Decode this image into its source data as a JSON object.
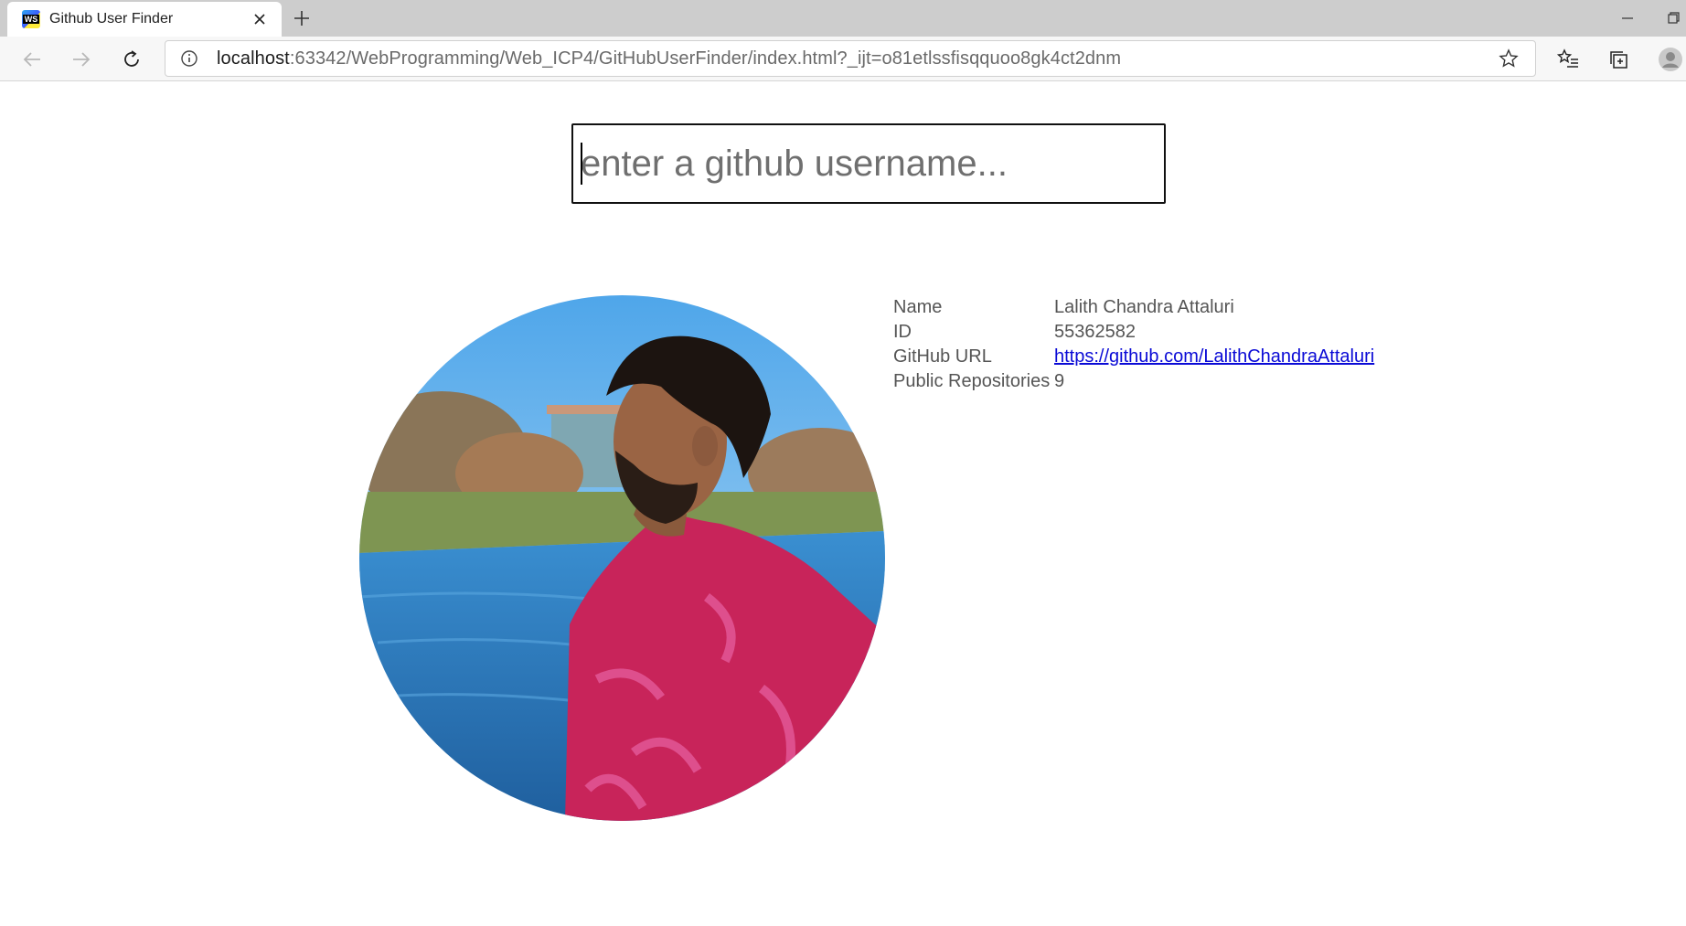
{
  "browser": {
    "tab_title": "Github User Finder",
    "favicon_text": "WS",
    "url_host": "localhost",
    "url_rest": ":63342/WebProgramming/Web_ICP4/GitHubUserFinder/index.html?_ijt=o81etlssfisqquoo8gk4ct2dnm"
  },
  "search": {
    "placeholder": "enter a github username..."
  },
  "profile": {
    "rows": [
      {
        "label": "Name",
        "value": "Lalith Chandra Attaluri"
      },
      {
        "label": "ID",
        "value": "55362582"
      },
      {
        "label": "GitHub URL",
        "value": "https://github.com/LalithChandraAttaluri"
      },
      {
        "label": "Public Repositories",
        "value": "9"
      }
    ]
  },
  "icons": {
    "tab": [
      "close-icon",
      "plus-icon"
    ],
    "window": [
      "minimize-icon",
      "restore-icon"
    ],
    "nav": [
      "back-arrow-icon",
      "forward-arrow-icon",
      "refresh-icon",
      "info-icon",
      "star-icon",
      "favorites-icon",
      "collections-icon",
      "profile-icon"
    ]
  }
}
